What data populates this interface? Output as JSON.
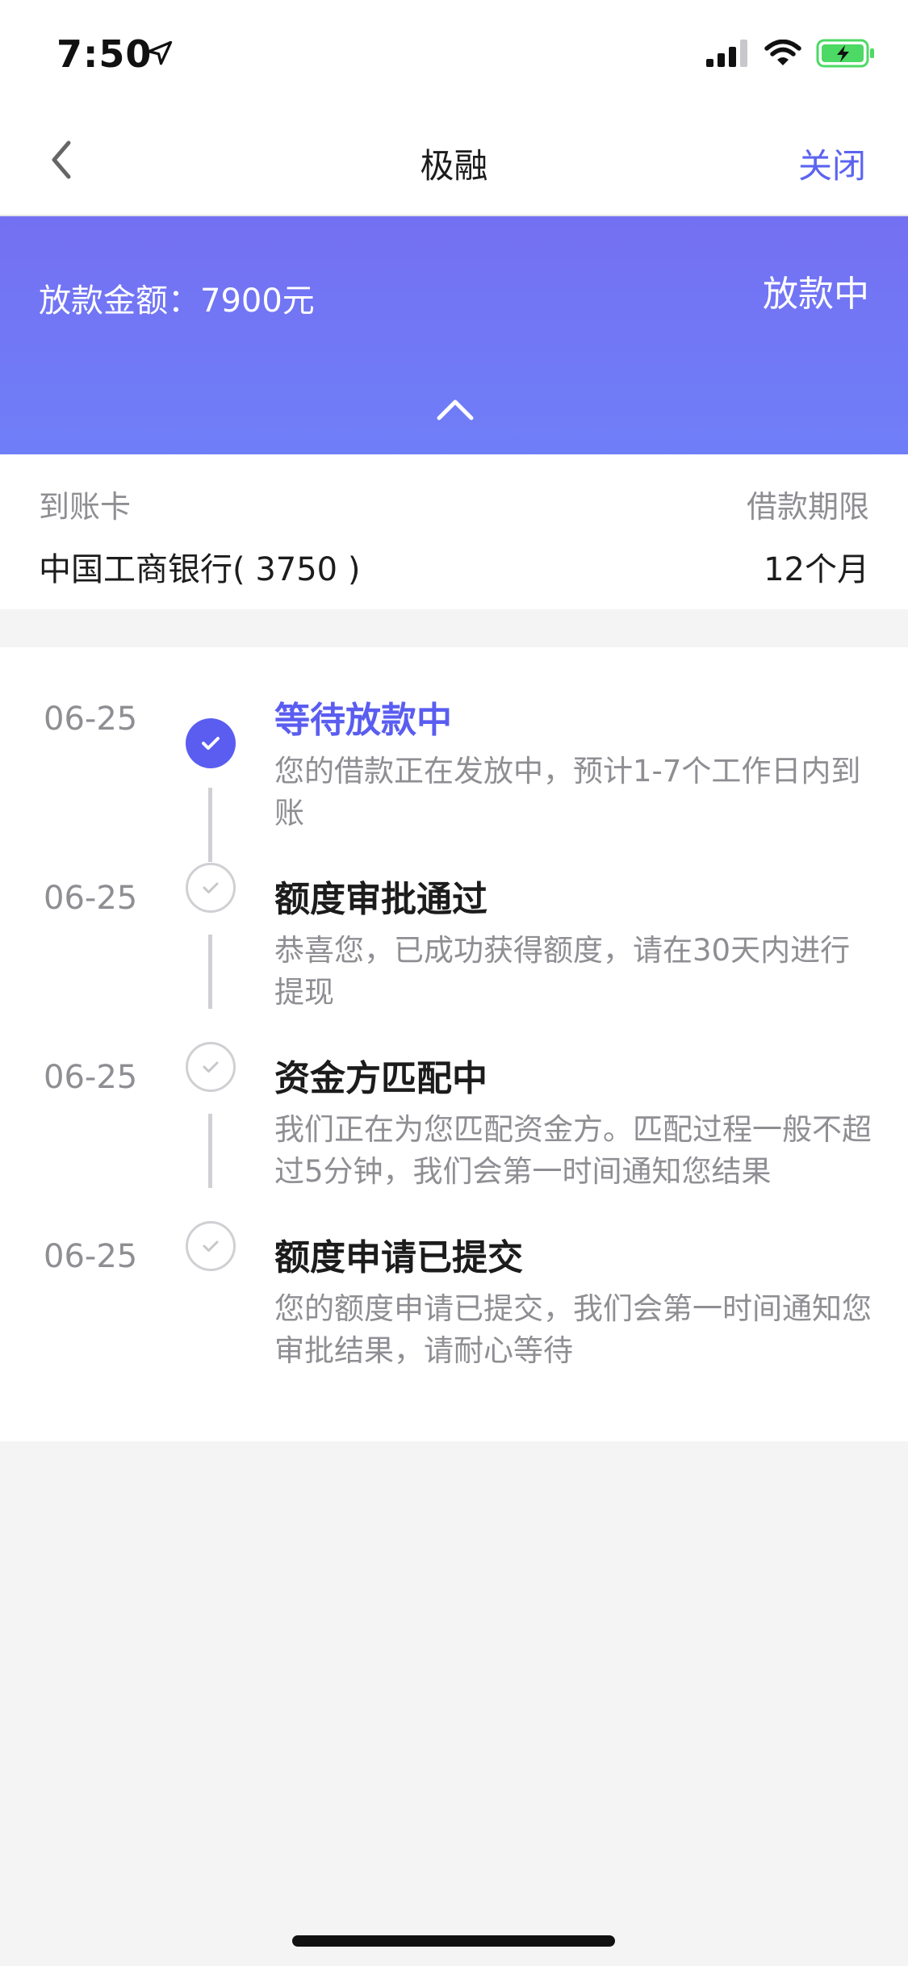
{
  "status_bar": {
    "time": "7:50"
  },
  "nav": {
    "title": "极融",
    "close_label": "关闭"
  },
  "banner": {
    "amount_label": "放款金额：7900元",
    "status": "放款中"
  },
  "info": {
    "card_label": "到账卡",
    "card_value": "中国工商银行( 3750 )",
    "term_label": "借款期限",
    "term_value": "12个月"
  },
  "timeline": {
    "steps": [
      {
        "date": "06-25",
        "title": "等待放款中",
        "desc": "您的借款正在发放中，预计1-7个工作日内到账",
        "state": "active"
      },
      {
        "date": "06-25",
        "title": "额度审批通过",
        "desc": "恭喜您，已成功获得额度，请在30天内进行提现",
        "state": "done"
      },
      {
        "date": "06-25",
        "title": "资金方匹配中",
        "desc": "我们正在为您匹配资金方。匹配过程一般不超过5分钟，我们会第一时间通知您结果",
        "state": "done"
      },
      {
        "date": "06-25",
        "title": "额度申请已提交",
        "desc": "您的额度申请已提交，我们会第一时间通知您审批结果，请耐心等待",
        "state": "done"
      }
    ]
  },
  "colors": {
    "accent": "#5a5df0",
    "banner_top": "#7470f2",
    "banner_bottom": "#6f7ff8",
    "battery": "#4cd964"
  },
  "icons": [
    "location-arrow-icon",
    "signal-icon",
    "wifi-icon",
    "battery-icon",
    "back-chevron-icon",
    "chevron-up-icon",
    "check-icon"
  ]
}
